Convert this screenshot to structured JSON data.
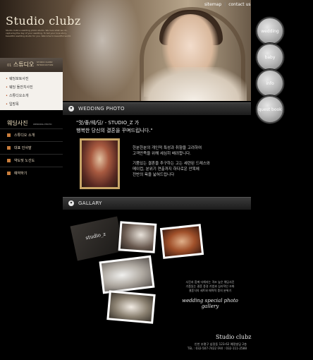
{
  "brand": {
    "logo": "Studio clubz",
    "tagline": "Studio clubz a wedding photo studio. We love what we do, capturing the day of your wedding. To tell your love story, beautiful wedding studio for you. Welcome to beautiful world."
  },
  "topnav": {
    "sitemap": "sitemap",
    "contact": "contact us"
  },
  "side_circles": [
    "wedding",
    "baby",
    "info",
    "quest book"
  ],
  "studio_menu": {
    "title": "스튜디오",
    "num": "01",
    "subtitle": "STUDIO CLUBZ INTRODUCTION",
    "items": [
      "웨딩포토사진",
      "웨딩 돌잔치사진",
      "스튜디오소개",
      "입방목"
    ]
  },
  "wedding_menu": {
    "title": "웨딩사진",
    "subtitle": "WEDDING PHOTO",
    "items": [
      "스튜디오 소개",
      "대표 인사말",
      "약도및 노선도",
      "예약하기"
    ]
  },
  "sections": {
    "wedding_photo": "WEDDING PHOTO",
    "gallery": "GALLARY"
  },
  "quote": {
    "line1": "\"멋/좋/웨/딩/ - STUDIO_Z 가",
    "line2": "행복한 당신의 결혼을 꾸며드립니다.\""
  },
  "description": {
    "p1a": "한분한분의 개인적 특성과 취향을 고려하여",
    "p1b": "고객만족을 위해 세심히 배려합니다.",
    "p2a": "기품있는 결혼을 추구하는 고는 세련된 드레스와",
    "p2b": "메이컵, 분위기 연출까지 하다로운 안목에",
    "p2c": "전반의 욕을 넓혀드립니다"
  },
  "gallery": {
    "card_label": "studio_z",
    "text1": "사진과 함께 더해지는 격조 높은 웨딩사진",
    "text2": "기품있는 결혼 풍경 기법과 심리적인 조화",
    "text3": "결혼식의 세트와 매력적 풍의 분위기",
    "title": "wedding special photo gallery"
  },
  "footer": {
    "logo": "Studio clubz",
    "address": "인천 부평구 십정동 123-62 예정빌딩 2층",
    "tel": "TEL : 032-507-7422  FAX : 032-111-2588"
  },
  "colors": {
    "accent": "#c97d3b",
    "bg": "#000000",
    "frame": "#c8a668"
  }
}
